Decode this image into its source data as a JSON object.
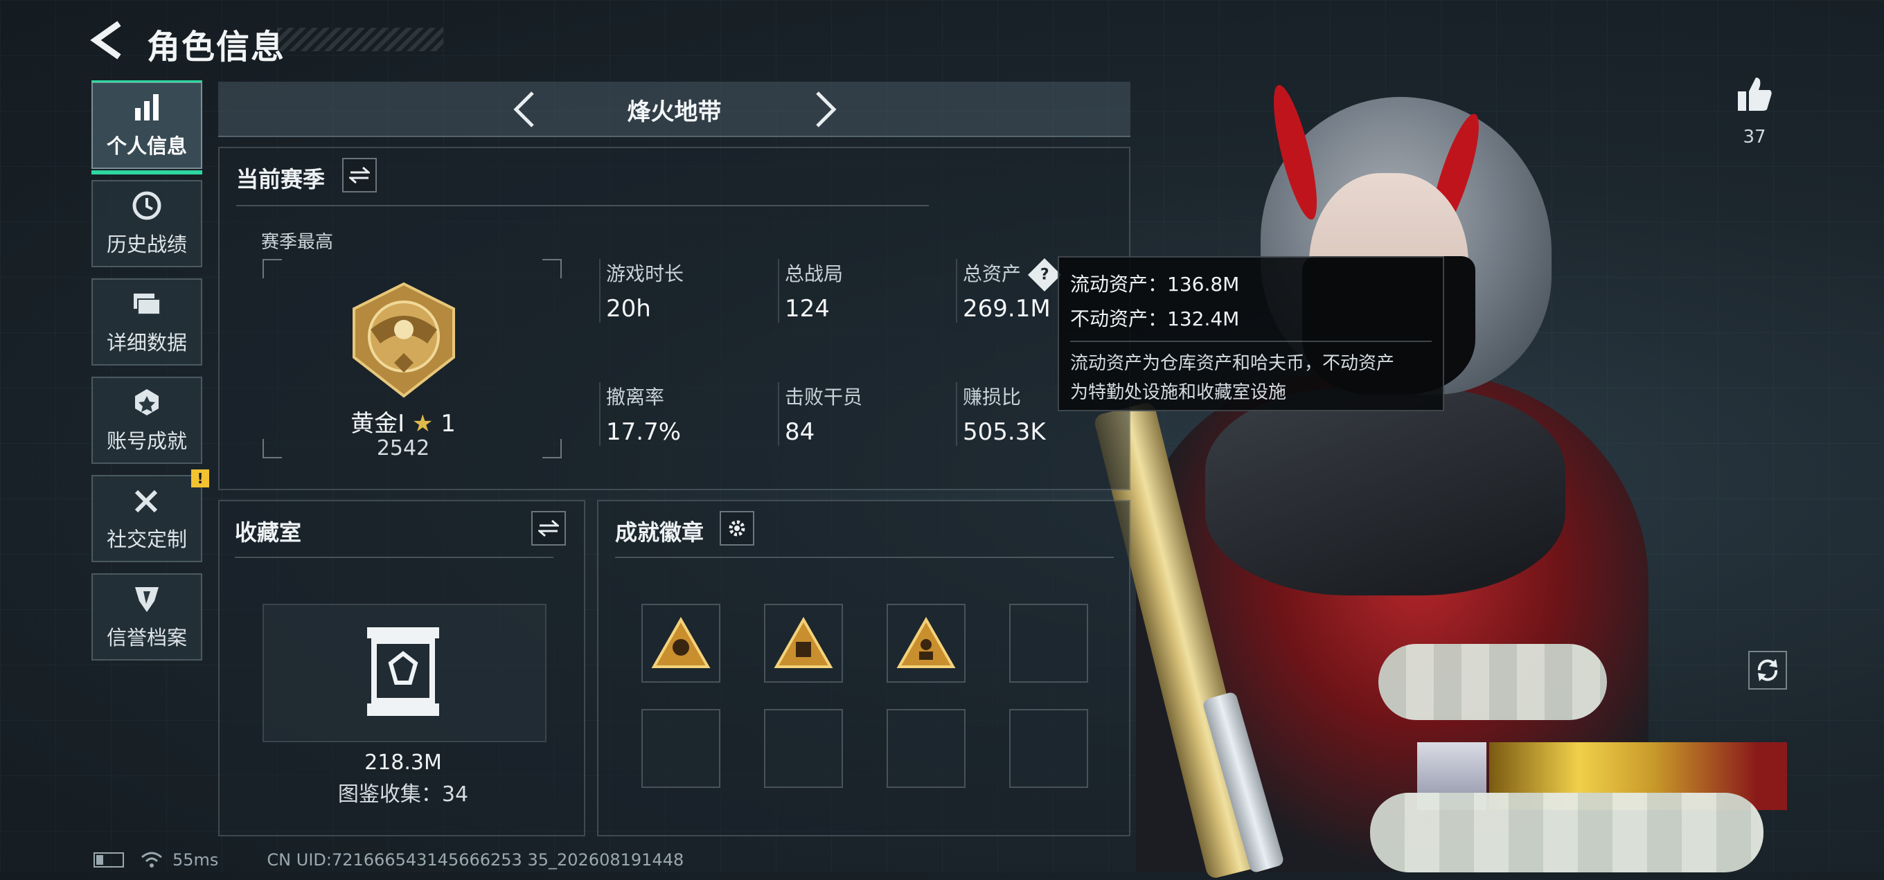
{
  "header": {
    "title": "角色信息"
  },
  "sidebar": {
    "items": [
      {
        "label": "个人信息",
        "icon": "bar-chart-icon",
        "active": true
      },
      {
        "label": "历史战绩",
        "icon": "clock-icon"
      },
      {
        "label": "详细数据",
        "icon": "folder-icon"
      },
      {
        "label": "账号成就",
        "icon": "achievement-icon"
      },
      {
        "label": "社交定制",
        "icon": "tools-icon",
        "alert": "!"
      },
      {
        "label": "信誉档案",
        "icon": "shield-icon"
      }
    ]
  },
  "mode": {
    "title": "烽火地带"
  },
  "season": {
    "title": "当前赛季",
    "best_label": "赛季最高",
    "rank_name": "黄金Ⅰ",
    "rank_stars": "1",
    "rank_score": "2542",
    "stats": [
      {
        "label": "游戏时长",
        "value": "20h"
      },
      {
        "label": "总战局",
        "value": "124"
      },
      {
        "label": "总资产",
        "value": "269.1M"
      },
      {
        "label": "撤离率",
        "value": "17.7%"
      },
      {
        "label": "击败干员",
        "value": "84"
      },
      {
        "label": "赚损比",
        "value": "505.3K"
      }
    ]
  },
  "tooltip": {
    "liquid": "流动资产：136.8M",
    "fixed": "不动资产：132.4M",
    "desc_1": "流动资产为仓库资产和哈夫币，不动资产",
    "desc_2": "为特勤处设施和收藏室设施"
  },
  "collection": {
    "title": "收藏室",
    "value": "218.3M",
    "count": "图鉴收集：34"
  },
  "achievements": {
    "title": "成就徽章"
  },
  "likes": {
    "count": "37"
  },
  "footer": {
    "ping": "55ms",
    "uid": "CN UID:721666543145666253 35_202608191448"
  },
  "colors": {
    "accent": "#2fd7a0",
    "gold": "#c8a050",
    "warn": "#f2c230"
  }
}
